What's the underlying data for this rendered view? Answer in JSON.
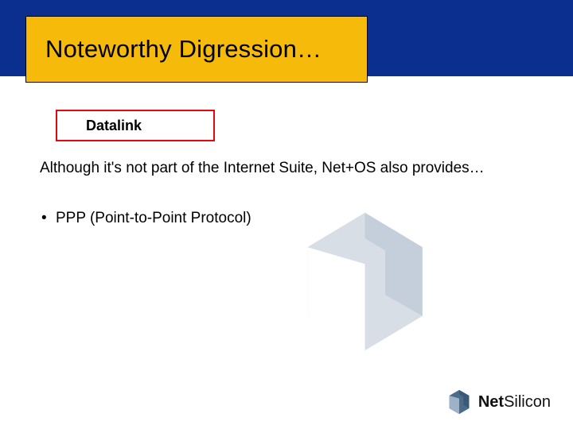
{
  "title": "Noteworthy Digression…",
  "subtitle": "Datalink",
  "body": "Although it's not part of the Internet Suite, Net+OS also provides…",
  "bullets": [
    "PPP (Point-to-Point Protocol)"
  ],
  "brand": {
    "prefix": "Net",
    "suffix": "Silicon"
  },
  "colors": {
    "topbar": "#0a2f8e",
    "title_bg": "#f6ba0a",
    "accent_red": "#e30613",
    "logo_fg": "#4b6b8a",
    "logo_bg": "#d7dee6"
  }
}
